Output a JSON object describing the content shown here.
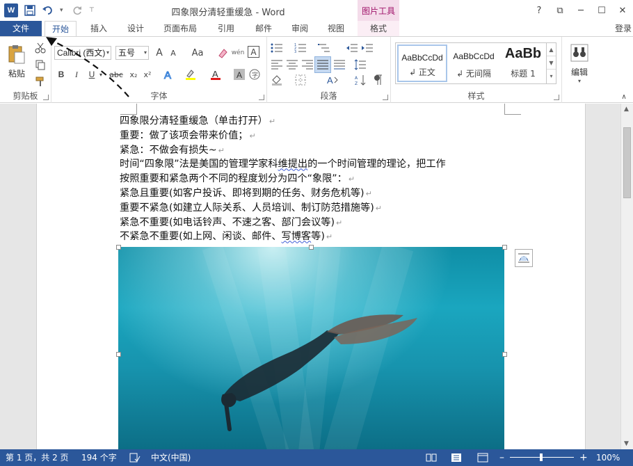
{
  "titlebar": {
    "title": "四象限分清轻重缓急 - Word",
    "context_tab_header": "图片工具",
    "app_icon_letter": "W",
    "help": "?",
    "ribbon_options": "⧉",
    "minimize": "─",
    "maximize": "☐",
    "close": "✕"
  },
  "tabs": {
    "file": "文件",
    "items": [
      "开始",
      "插入",
      "设计",
      "页面布局",
      "引用",
      "邮件",
      "审阅",
      "视图",
      "格式"
    ],
    "active": "开始",
    "login": "登录"
  },
  "ribbon": {
    "clipboard": {
      "label": "剪贴板",
      "paste": "粘贴"
    },
    "font": {
      "label": "字体",
      "font_name": "Calibri (西文)",
      "font_size": "五号",
      "bold": "B",
      "italic": "I",
      "underline": "U",
      "strike": "abc",
      "subscript": "x₂",
      "superscript": "x²",
      "grow": "A",
      "shrink": "A",
      "case": "Aa",
      "phonetic": "wén",
      "border_char": "A"
    },
    "paragraph": {
      "label": "段落"
    },
    "styles": {
      "label": "样式",
      "items": [
        {
          "sample": "AaBbCcDd",
          "name": "↲ 正文"
        },
        {
          "sample": "AaBbCcDd",
          "name": "↲ 无间隔"
        },
        {
          "sample": "AaBb",
          "name": "标题 1"
        }
      ]
    },
    "editing": {
      "label": "编辑"
    }
  },
  "document": {
    "lines": [
      "四象限分清轻重缓急（单击打开）",
      "重要：做了该项会带来价值；",
      "紧急：不做会有损失~",
      "时间“四象限”法是美国的管理学家科维提出的一个时间管理的理论，把工作",
      "按照重要和紧急两个不同的程度划分为四个“象限”：",
      "紧急且重要(如客户投诉、即将到期的任务、财务危机等)",
      "重要不紧急(如建立人际关系、人员培训、制订防范措施等)",
      "紧急不重要(如电话铃声、不速之客、部门会议等)",
      "不紧急不重要(如上网、闲谈、邮件、写博客等)"
    ],
    "line3_parts": [
      "时间“四象限”法是美国的管理学家科",
      "维提出",
      "的一个时间管理的理论，把工作"
    ],
    "line8_parts": [
      "不紧急不重要(如上网、闲谈、邮件、",
      "写博客",
      "等)"
    ],
    "paragraph_mark": "↵"
  },
  "statusbar": {
    "page_info": "第 1 页，共 2 页",
    "word_count": "194 个字",
    "language": "中文(中国)",
    "zoom_minus": "–",
    "zoom_plus": "+",
    "zoom": "100%",
    "zoom_value": 1.0
  },
  "colors": {
    "accent": "#2b579a",
    "context_tab": "#a0156b",
    "context_tab_bg": "#f4dcea"
  }
}
